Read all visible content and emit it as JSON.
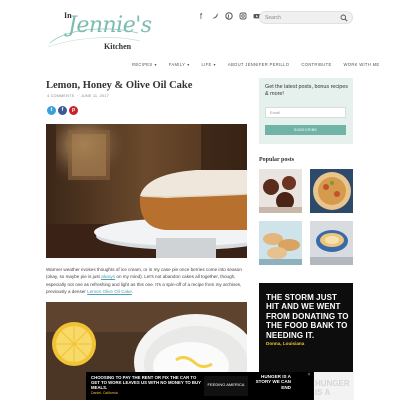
{
  "site": {
    "logo_in": "In",
    "logo_name": "Jennie's",
    "logo_kitchen": "Kitchen"
  },
  "social_icons": [
    "facebook-icon",
    "twitter-icon",
    "pinterest-icon",
    "instagram-icon",
    "youtube-icon",
    "email-icon"
  ],
  "search": {
    "placeholder": "Search"
  },
  "nav": [
    {
      "label": "RECIPES",
      "has_menu": true
    },
    {
      "label": "FAMILY",
      "has_menu": true
    },
    {
      "label": "LIFE",
      "has_menu": true
    },
    {
      "label": "ABOUT JENNIFER PERILLO",
      "has_menu": false
    },
    {
      "label": "CONTRIBUTE",
      "has_menu": false
    },
    {
      "label": "WORK WITH ME",
      "has_menu": false
    }
  ],
  "post": {
    "title": "Lemon, Honey & Olive Oil Cake",
    "comments": "4 COMMENTS",
    "date": "JUNE 11, 2017",
    "body_1": "Warmer weather evokes thoughts of ice cream, or in my case pie once berries come into season (okay, so maybe pie is just ",
    "link_1": "always",
    "body_2": " on my mind). Let's not abandon cakes all together, though, especially not one as refreshing and light as this one. It's a spin-off of a recipe from my archives, previously a denser ",
    "link_2": "Lemon Olive Oil Cake",
    "body_3": "."
  },
  "subscribe": {
    "heading": "Get the latest posts, bonus recipes & more!",
    "email_placeholder": "Email",
    "button": "SUBSCRIBE"
  },
  "popular": {
    "heading": "Popular posts"
  },
  "side_ad": {
    "headline": "THE STORM JUST HIT AND WE WENT FROM DONATING TO THE FOOD BANK TO NEEDING IT.",
    "attribution": "Donna, Louisiana"
  },
  "bottom_ad": {
    "left": "CHOOSING TO PAY THE RENT OR FIX THE CAR TO GET TO WORK LEAVES US WITH NO MONEY TO BUY MEALS.",
    "source": "Daniel, California",
    "org": "FEEDING AMERICA",
    "right": "HUNGER IS A STORY WE CAN END",
    "ghost": "HUNGER IS A"
  },
  "colors": {
    "accent": "#6fb4a7",
    "link": "#4e9fb2",
    "brand_teal": "#7bbcb0",
    "ad_yellow": "#f0c330"
  }
}
